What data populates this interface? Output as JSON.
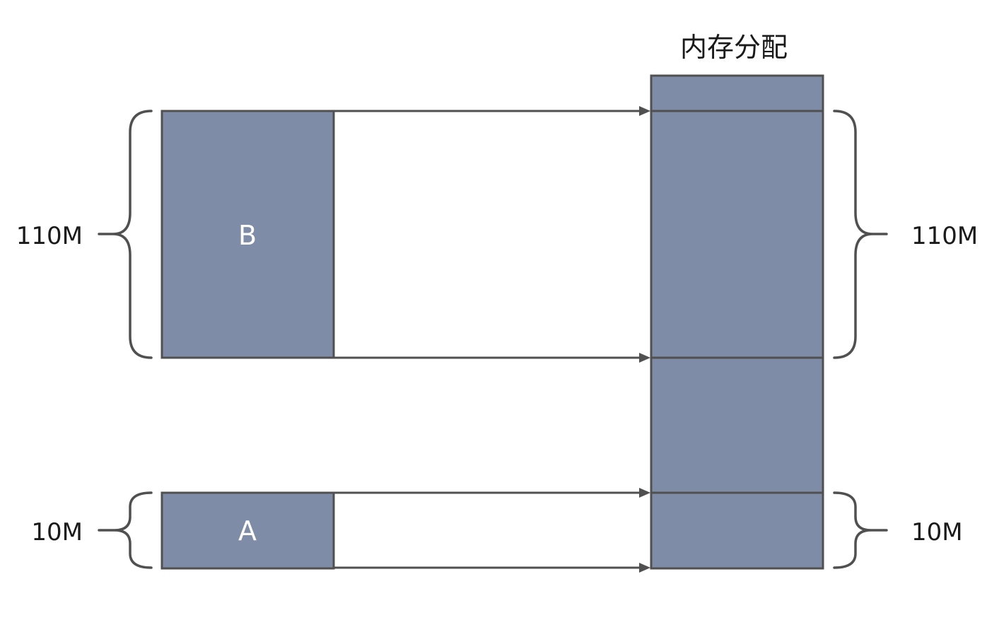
{
  "title": "内存分配",
  "blocks": {
    "a": {
      "label": "A",
      "size": "10M"
    },
    "b": {
      "label": "B",
      "size": "110M"
    }
  },
  "memory": {
    "upper_size": "110M",
    "lower_size": "10M"
  },
  "colors": {
    "block_fill": "#7f8ca8",
    "stroke": "#505050",
    "text": "#1a1a1a"
  }
}
